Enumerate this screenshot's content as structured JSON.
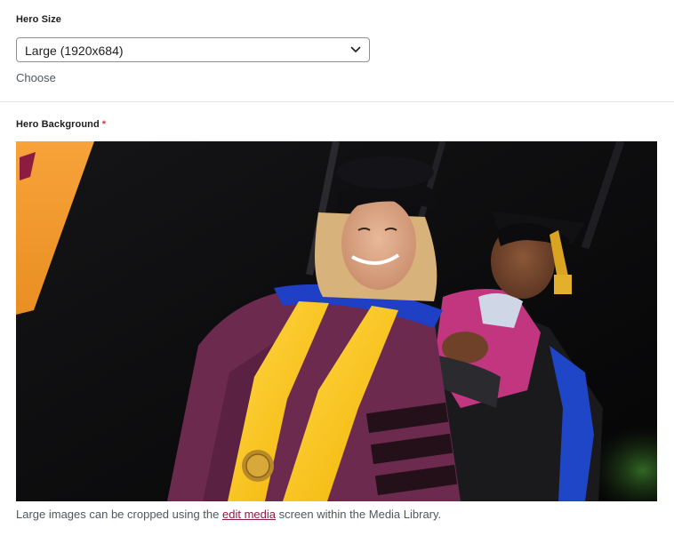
{
  "hero_size": {
    "label": "Hero Size",
    "selected_value": "Large (1920x684)",
    "choose_label": "Choose"
  },
  "hero_background": {
    "label": "Hero Background",
    "required_marker": "*",
    "image_alt": "Graduate receiving doctoral hood at commencement",
    "help_before": "Large images can be cropped using the ",
    "help_link": "edit media",
    "help_after": " screen within the Media Library."
  },
  "colors": {
    "required": "#d63638",
    "link": "#8c1d40",
    "muted_text": "#50575e",
    "border": "#8c8f94"
  },
  "icons": {
    "select_chevron": "chevron-down-icon"
  }
}
